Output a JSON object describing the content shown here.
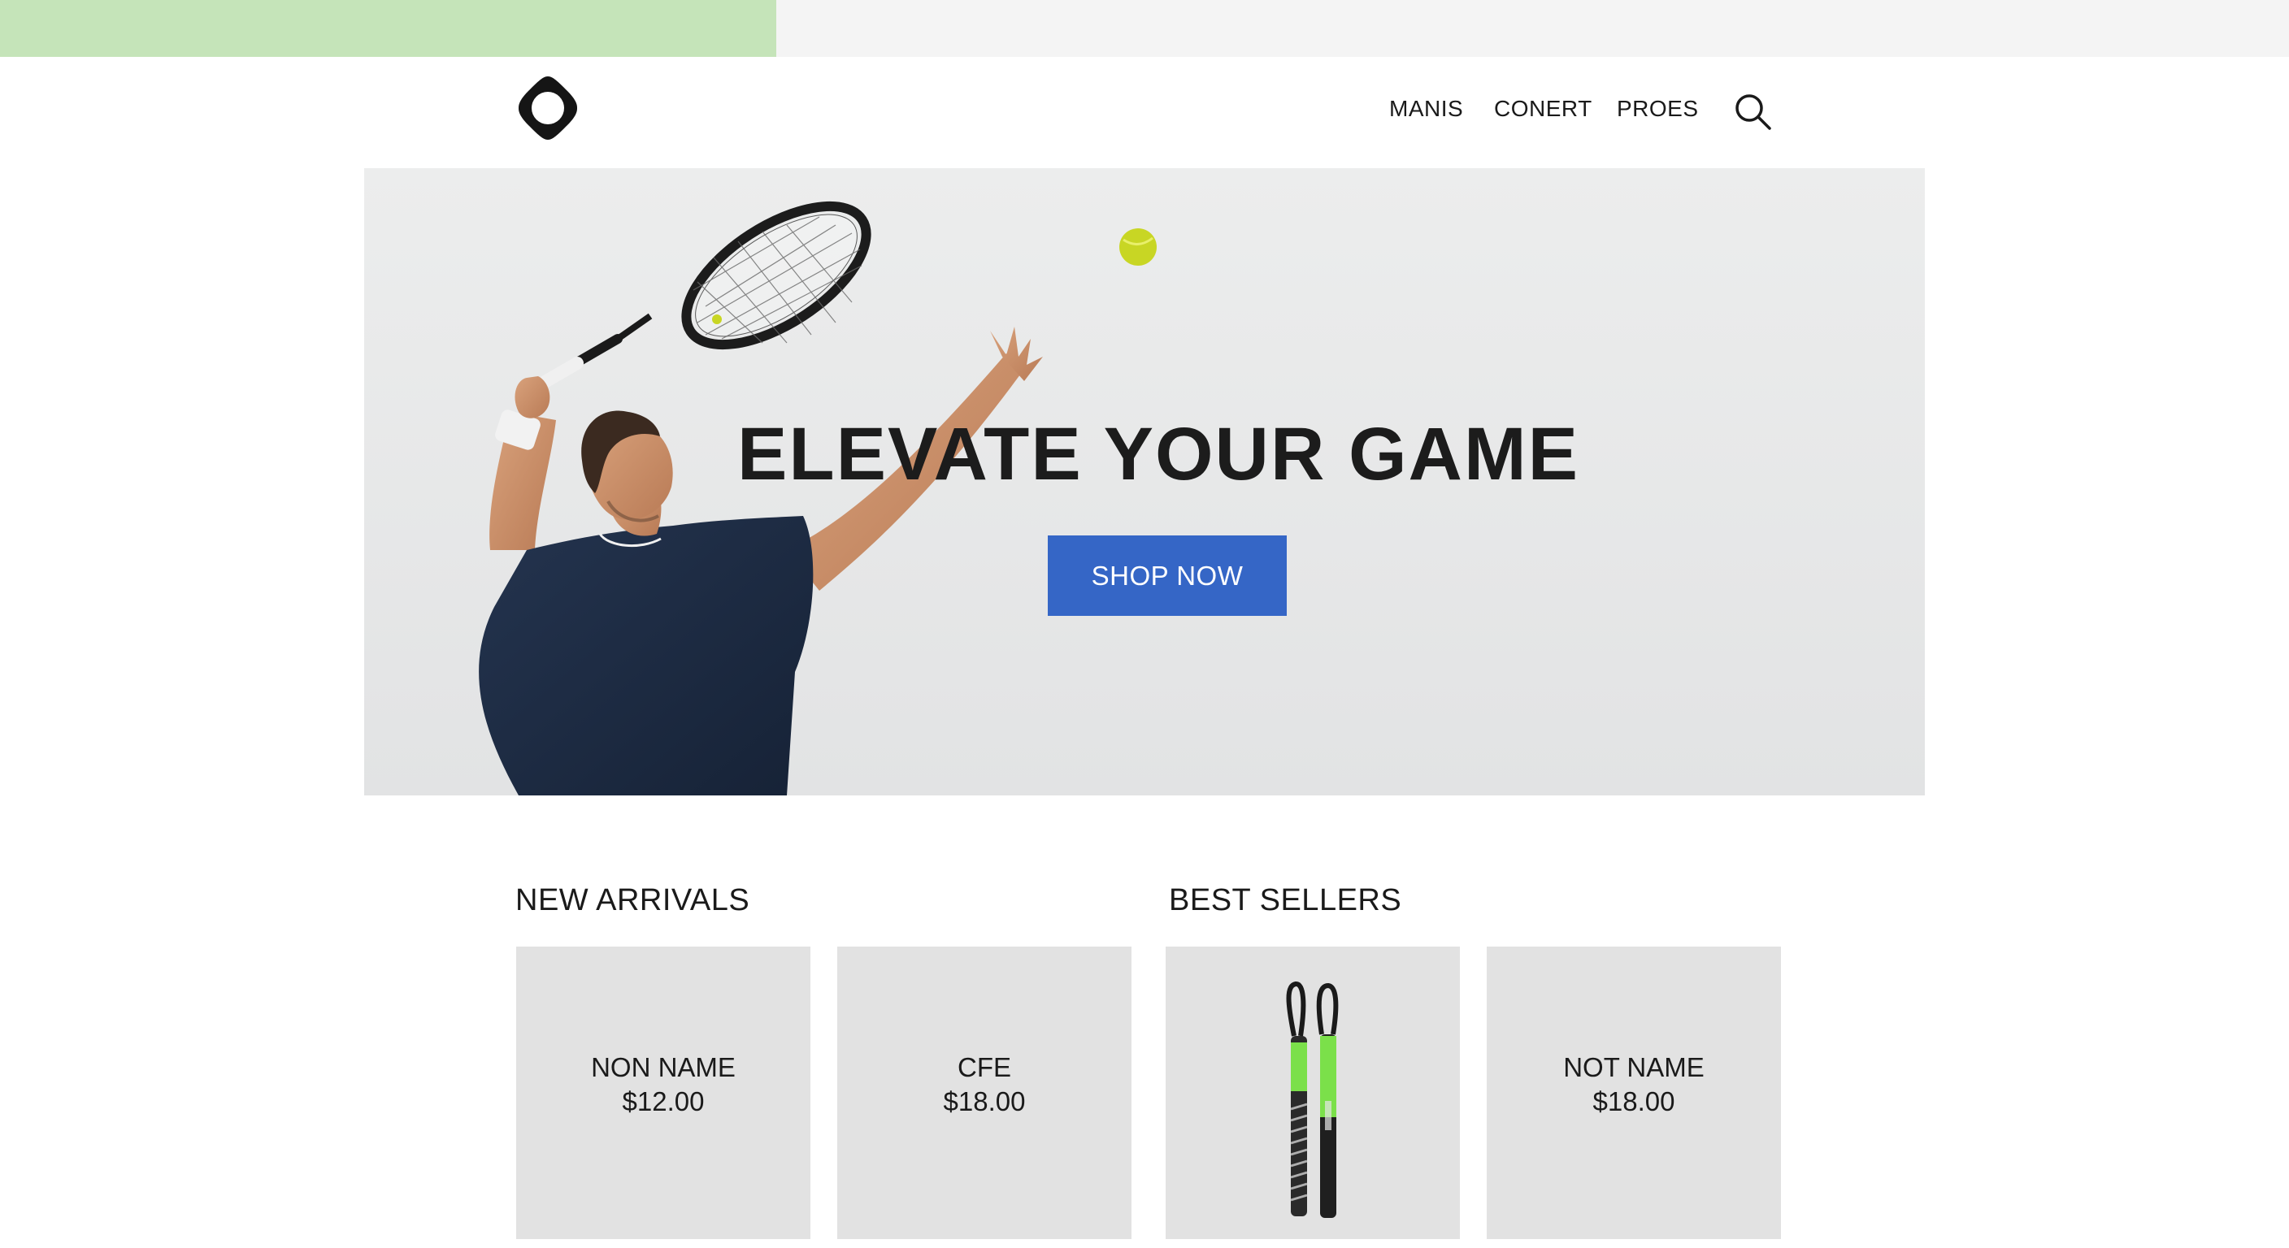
{
  "colors": {
    "top_accent": "#c5e4b9",
    "shop_button": "#3566c6",
    "card_background": "#e2e2e2",
    "grip_accent": "#7be04a"
  },
  "header": {
    "logo_icon": "rounded-ring-logo-icon",
    "nav": [
      "MANIS",
      "CONERT",
      "PROES"
    ],
    "search_icon": "search-icon"
  },
  "hero": {
    "title": "ELEVATE YOUR GAME",
    "button_label": "SHOP NOW"
  },
  "sections": {
    "new_arrivals": {
      "title": "NEW ARRIVALS",
      "products": [
        {
          "name": "NON NAME",
          "price": "$12.00"
        },
        {
          "name": "CFE",
          "price": "$18.00"
        }
      ]
    },
    "best_sellers": {
      "title": "BEST SELLERS",
      "products": [
        {
          "name": "",
          "price": "",
          "image": "racket-grip-image"
        },
        {
          "name": "NOT NAME",
          "price": "$18.00"
        }
      ]
    }
  }
}
